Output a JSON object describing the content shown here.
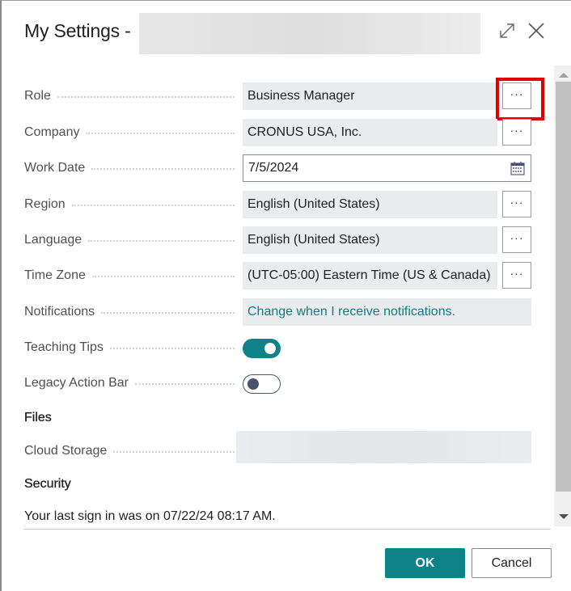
{
  "dialog": {
    "title": "My Settings -",
    "expand_icon": "expand-icon",
    "close_icon": "close-icon"
  },
  "fields": {
    "role": {
      "label": "Role",
      "value": "Business Manager"
    },
    "company": {
      "label": "Company",
      "value": "CRONUS USA, Inc."
    },
    "work_date": {
      "label": "Work Date",
      "value": "7/5/2024"
    },
    "region": {
      "label": "Region",
      "value": "English (United States)"
    },
    "language": {
      "label": "Language",
      "value": "English (United States)"
    },
    "time_zone": {
      "label": "Time Zone",
      "value": "(UTC-05:00) Eastern Time (US & Canada)"
    },
    "notifications": {
      "label": "Notifications",
      "value": "Change when I receive notifications."
    },
    "teaching_tips": {
      "label": "Teaching Tips",
      "state": "on"
    },
    "legacy_action_bar": {
      "label": "Legacy Action Bar",
      "state": "off"
    }
  },
  "ellipsis": "···",
  "files": {
    "heading": "Files",
    "cloud_storage_label": "Cloud Storage"
  },
  "security": {
    "heading": "Security",
    "last_sign_in": "Your last sign in was on 07/22/24 08:17 AM."
  },
  "footer": {
    "ok_label": "OK",
    "cancel_label": "Cancel"
  },
  "colors": {
    "accent": "#0f8289",
    "link": "#0f7d86",
    "highlight": "#e00000"
  }
}
